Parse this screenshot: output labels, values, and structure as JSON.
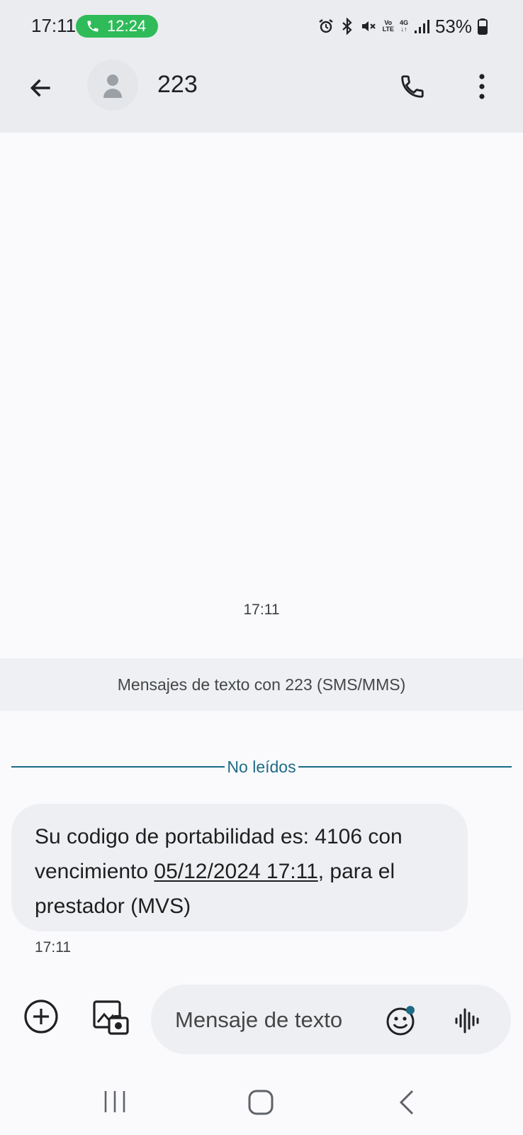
{
  "status_bar": {
    "time": "17:11",
    "call_duration": "12:24",
    "volte_top": "Vo",
    "volte_bottom": "LTE",
    "network": "4G",
    "battery_percent": "53%",
    "icons": [
      "alarm-icon",
      "bluetooth-icon",
      "mute-icon",
      "volte-icon",
      "network-4g-icon",
      "signal-icon",
      "battery-icon"
    ]
  },
  "header": {
    "contact_name": "223",
    "icons": [
      "back-arrow-icon",
      "avatar-person-icon",
      "phone-icon",
      "more-vert-icon"
    ]
  },
  "conversation": {
    "date_time": "17:11",
    "banner": "Mensajes de texto con 223 (SMS/MMS)",
    "unread_label": "No leídos",
    "message": {
      "part1": "Su codigo de portabilidad es: 4106 con vencimiento ",
      "date_link": "05/12/2024 17:11",
      "part2": ", para el prestador (MVS)",
      "time": "17:11"
    }
  },
  "composer": {
    "placeholder": "Mensaje de texto",
    "icons": [
      "add-circle-icon",
      "gallery-camera-icon",
      "emoji-icon",
      "voice-waveform-icon"
    ]
  },
  "nav_bar": {
    "icons": [
      "recents-icon",
      "home-icon",
      "nav-back-icon"
    ]
  },
  "colors": {
    "header_bg": "#eaecef",
    "page_bg": "#fafafd",
    "bubble_bg": "#eeeff2",
    "call_pill": "#2fbb59",
    "unread_accent": "#1d6b84"
  }
}
